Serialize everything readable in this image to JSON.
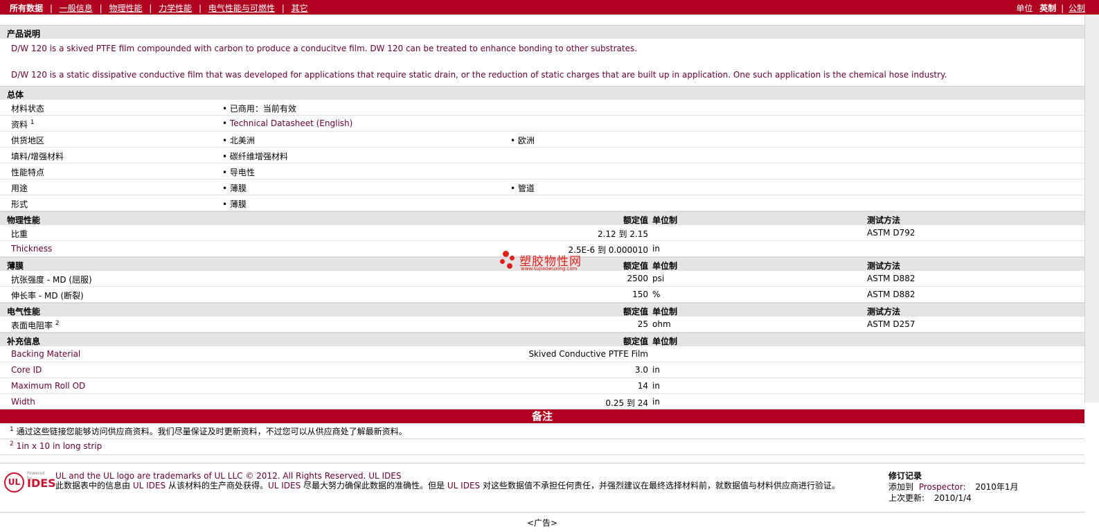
{
  "nav": {
    "active": "所有数据",
    "items": [
      "一般信息",
      "物理性能",
      "力学性能",
      "电气性能与可燃性",
      "其它"
    ],
    "units_label": "单位",
    "units_active": "英制",
    "units_other": "公制"
  },
  "description": {
    "header": "产品说明",
    "paragraphs": [
      "D/W 120 is a skived PTFE film compounded with carbon to produce a conducitve film. DW 120 can be treated to enhance bonding to other substrates.",
      "D/W 120 is a static dissipative conductive film that was developed for applications that require static drain, or the reduction of static charges that are built up in application. One such application is the chemical hose industry."
    ]
  },
  "general": {
    "header": "总体",
    "rows": [
      {
        "label": "材料状态",
        "b1": "已商用：当前有效",
        "b2": ""
      },
      {
        "label": "资料",
        "sup": "1",
        "b1": "Technical Datasheet (English)",
        "b2": ""
      },
      {
        "label": "供货地区",
        "b1": "北美洲",
        "b2": "欧洲"
      },
      {
        "label": "填料/增强材料",
        "b1": "碳纤维增强材料",
        "b2": ""
      },
      {
        "label": "性能特点",
        "b1": "导电性",
        "b2": ""
      },
      {
        "label": "用途",
        "b1": "薄膜",
        "b2": "管道"
      },
      {
        "label": "形式",
        "b1": "薄膜",
        "b2": ""
      }
    ]
  },
  "col_heads": {
    "value": "额定值",
    "unit": "单位制",
    "test": "测试方法"
  },
  "physical": {
    "header": "物理性能",
    "rows": [
      {
        "label": "比重",
        "value": "2.12 到  2.15",
        "unit": "",
        "test": "ASTM D792"
      },
      {
        "label": "Thickness",
        "value": "2.5E-6 到  0.000010",
        "unit": "in",
        "test": ""
      }
    ]
  },
  "film": {
    "header": "薄膜",
    "rows": [
      {
        "label": "抗张强度  - MD (屈服)",
        "value": "2500",
        "unit": "psi",
        "test": "ASTM D882"
      },
      {
        "label": "伸长率  - MD (断裂)",
        "value": "150",
        "unit": "%",
        "test": "ASTM D882"
      }
    ]
  },
  "electrical": {
    "header": "电气性能",
    "rows": [
      {
        "label": "表面电阻率",
        "sup": "2",
        "value": "25",
        "unit": "ohm",
        "test": "ASTM D257"
      }
    ]
  },
  "supplemental": {
    "header": "补充信息",
    "rows": [
      {
        "label": "Backing Material",
        "value": "Skived Conductive PTFE Film",
        "unit": "",
        "test": ""
      },
      {
        "label": "Core ID",
        "value": "3.0",
        "unit": "in",
        "test": ""
      },
      {
        "label": "Maximum Roll OD",
        "value": "14",
        "unit": "in",
        "test": ""
      },
      {
        "label": "Width",
        "value": "0.25 到  24",
        "unit": "in",
        "test": ""
      }
    ]
  },
  "notes": {
    "header": "备注",
    "items": [
      {
        "num": "1",
        "text": "通过这些链接您能够访问供应商资料。我们尽量保证及时更新资料，不过您可以从供应商处了解最新资料。"
      },
      {
        "num": "2",
        "text": "1in x 10 in long strip"
      }
    ]
  },
  "watermark": {
    "name": "塑胶物性网",
    "url": "www.sujiaowuxing.com"
  },
  "footer": {
    "logo_ul": "UL",
    "logo_powered": "Powered by",
    "logo_ides": "IDES",
    "trademark": "UL and the UL logo are trademarks of UL LLC © 2012. All Rights Reserved.",
    "trademark_link": "UL IDES",
    "legal_a": "此数据表中的信息由",
    "legal_link1": "UL IDES",
    "legal_b": "从该材料的生产商处获得。",
    "legal_link2": "UL IDES",
    "legal_c": "尽最大努力确保此数据的准确性。但是",
    "legal_link3": "UL IDES",
    "legal_d": "对这些数据值不承担任何责任，并强烈建议在最终选择材料前，就数据值与材料供应商进行验证。",
    "rev_header": "修订记录",
    "rev_added_label": "添加到",
    "rev_added_link": "Prospector:",
    "rev_added_date": "2010年1月",
    "rev_updated_label": "上次更新:",
    "rev_updated_date": "2010/1/4"
  },
  "ad": "<广告>"
}
